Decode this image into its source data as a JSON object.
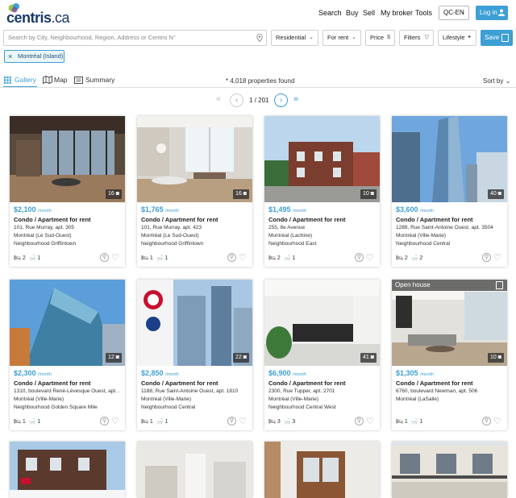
{
  "app": {
    "logo_text": "centris",
    "logo_suffix": ".ca"
  },
  "header": {
    "nav": [
      "Search",
      "Buy",
      "Sell",
      "My broker",
      "Tools"
    ],
    "lang": "QC-EN",
    "login_label": "Log in"
  },
  "search": {
    "placeholder": "Search by City, Neighbourhood, Region, Address or Centris N°",
    "property_type": "Residential",
    "transaction": "For rent",
    "price_label": "Price",
    "filters_label": "Filters",
    "lifestyle_label": "Lifestyle",
    "save_label": "Save",
    "chip": "Montréal (Island)"
  },
  "views": {
    "gallery": "Gallery",
    "map": "Map",
    "summary": "Summary",
    "found": "* 4,018 properties found",
    "sort": "Sort by"
  },
  "pager": {
    "text": "1 / 201"
  },
  "listings": [
    {
      "price": "$2,100",
      "unit": "/month",
      "type": "Condo / Apartment for rent",
      "address": "101, Rue Murray, apt. 305",
      "city": "Montréal (Le Sud-Ouest)",
      "area": "Neighbourhood Griffintown",
      "beds": "2",
      "baths": "1",
      "photos": "16"
    },
    {
      "price": "$1,765",
      "unit": "/month",
      "type": "Condo / Apartment for rent",
      "address": "101, Rue Murray, apt. 423",
      "city": "Montréal (Le Sud-Ouest)",
      "area": "Neighbourhood Griffintown",
      "beds": "1",
      "baths": "1",
      "photos": "16"
    },
    {
      "price": "$1,495",
      "unit": "/month",
      "type": "Condo / Apartment for rent",
      "address": "255, 8e Avenue",
      "city": "Montréal (Lachine)",
      "area": "Neighbourhood East",
      "beds": "2",
      "baths": "1",
      "photos": "10"
    },
    {
      "price": "$3,600",
      "unit": "/month",
      "type": "Condo / Apartment for rent",
      "address": "1288, Rue Saint-Antoine Ouest, apt. 3504",
      "city": "Montréal (Ville-Marie)",
      "area": "Neighbourhood Central",
      "beds": "2",
      "baths": "2",
      "photos": "40"
    },
    {
      "price": "$2,300",
      "unit": "/month",
      "type": "Condo / Apartment for rent",
      "address": "1310, boulevard René-Lévesque Ouest, apt. ...",
      "city": "Montréal (Ville-Marie)",
      "area": "Neighbourhood Golden Square Mile",
      "beds": "1",
      "baths": "1",
      "photos": "12"
    },
    {
      "price": "$2,850",
      "unit": "/month",
      "type": "Condo / Apartment for rent",
      "address": "1188, Rue Saint-Antoine Ouest, apt. 1810",
      "city": "Montréal (Ville-Marie)",
      "area": "Neighbourhood Central",
      "beds": "1",
      "baths": "1",
      "photos": "22"
    },
    {
      "price": "$6,900",
      "unit": "/month",
      "type": "Condo / Apartment for rent",
      "address": "2300, Rue Tupper, apt. 2701",
      "city": "Montréal (Ville-Marie)",
      "area": "Neighbourhood Central West",
      "beds": "3",
      "baths": "3",
      "photos": "41"
    },
    {
      "price": "$1,305",
      "unit": "/month",
      "type": "Condo / Apartment for rent",
      "address": "6760, boulevard Newman, apt. 506",
      "city": "Montréal (LaSalle)",
      "area": "",
      "beds": "1",
      "baths": "1",
      "photos": "10",
      "badge": "Open house"
    }
  ],
  "colors": {
    "accent": "#3d9fd6",
    "logo_navy": "#1a3a6b"
  }
}
